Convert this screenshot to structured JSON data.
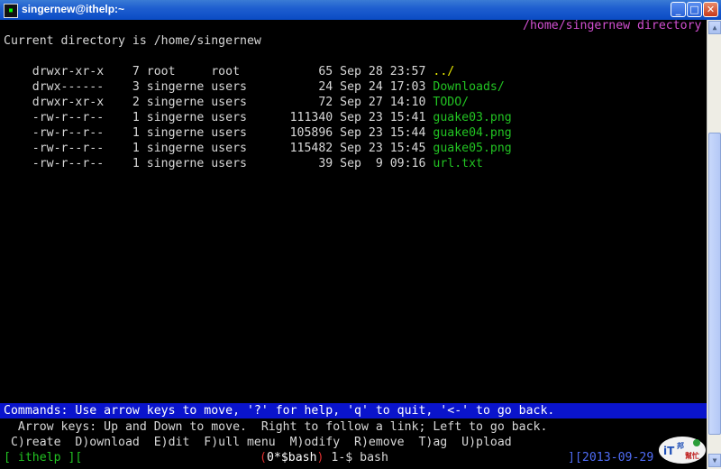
{
  "window": {
    "title": "singernew@ithelp:~",
    "buttons": {
      "minimize": "_",
      "maximize": "□",
      "close": "✕"
    }
  },
  "lynx": {
    "header_right": "/home/singernew directory",
    "current_dir_line": "Current directory is /home/singernew",
    "entries": [
      {
        "perms": "drwxr-xr-x",
        "links": "7",
        "owner": "root",
        "group": "root",
        "size": "65",
        "date": "Sep 28 23:57",
        "name": "../",
        "color": "#e8e800"
      },
      {
        "perms": "drwx------",
        "links": "3",
        "owner": "singerne",
        "group": "users",
        "size": "24",
        "date": "Sep 24 17:03",
        "name": "Downloads/",
        "color": "#22c322"
      },
      {
        "perms": "drwxr-xr-x",
        "links": "2",
        "owner": "singerne",
        "group": "users",
        "size": "72",
        "date": "Sep 27 14:10",
        "name": "TODO/",
        "color": "#22c322"
      },
      {
        "perms": "-rw-r--r--",
        "links": "1",
        "owner": "singerne",
        "group": "users",
        "size": "111340",
        "date": "Sep 23 15:41",
        "name": "guake03.png",
        "color": "#22c322"
      },
      {
        "perms": "-rw-r--r--",
        "links": "1",
        "owner": "singerne",
        "group": "users",
        "size": "105896",
        "date": "Sep 23 15:44",
        "name": "guake04.png",
        "color": "#22c322"
      },
      {
        "perms": "-rw-r--r--",
        "links": "1",
        "owner": "singerne",
        "group": "users",
        "size": "115482",
        "date": "Sep 23 15:45",
        "name": "guake05.png",
        "color": "#22c322"
      },
      {
        "perms": "-rw-r--r--",
        "links": "1",
        "owner": "singerne",
        "group": "users",
        "size": "39",
        "date": "Sep  9 09:16",
        "name": "url.txt",
        "color": "#22c322"
      }
    ],
    "status_line": "Commands: Use arrow keys to move, '?' for help, 'q' to quit, '<-' to go back.",
    "help_line": "  Arrow keys: Up and Down to move.  Right to follow a link; Left to go back.",
    "menu_line": " C)reate  D)ownload  E)dit  F)ull menu  M)odify  R)emove  T)ag  U)pload"
  },
  "screen_bar": {
    "left": "[ ithelp ][",
    "active_window": "(0*$bash)",
    "other_window": " 1-$ bash",
    "right": "][2013-09-29 "
  },
  "logo": {
    "text": "iT邦幫忙"
  },
  "colors": {
    "title_gradient": "#1f5fd0",
    "status_bg": "#0a14cc",
    "link": "#22c322",
    "parent_link": "#e8e800",
    "header": "#d14fd1"
  }
}
